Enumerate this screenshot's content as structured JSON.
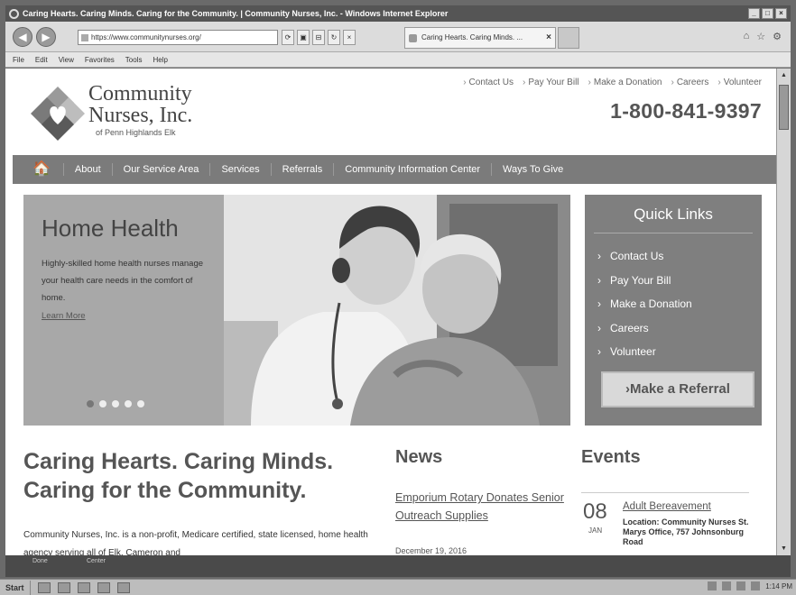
{
  "window": {
    "title": "Caring Hearts. Caring Minds. Caring for the Community. | Community Nurses, Inc. - Windows Internet Explorer",
    "controls": [
      "_",
      "□",
      "×"
    ]
  },
  "browser": {
    "url": "https://www.communitynurses.org/",
    "tab_title": "Caring Hearts. Caring Minds. ...",
    "tab_close": "×",
    "back": "◀",
    "forward": "▶",
    "address_buttons": [
      "⟳",
      "▣",
      "⊟",
      "↻",
      "×"
    ],
    "right_icons": [
      "⌂",
      "☆",
      "⚙"
    ],
    "menu": [
      "File",
      "Edit",
      "View",
      "Favorites",
      "Tools",
      "Help"
    ]
  },
  "site": {
    "brand_line1": "Community",
    "brand_line2": "Nurses, Inc.",
    "brand_line3": "of Penn Highlands Elk",
    "utility_links": [
      "Contact Us",
      "Pay Your Bill",
      "Make a Donation",
      "Careers",
      "Volunteer"
    ],
    "phone": "1-800-841-9397",
    "nav": {
      "home": "🏠",
      "items": [
        "About",
        "Our Service Area",
        "Services",
        "Referrals",
        "Community Information Center",
        "Ways To Give"
      ]
    },
    "hero": {
      "title": "Home Health",
      "description": "Highly-skilled home health nurses manage your health care needs in the comfort of home.",
      "link": "Learn More"
    },
    "quick_links": {
      "title": "Quick Links",
      "items": [
        "Contact Us",
        "Pay Your Bill",
        "Make a Donation",
        "Careers",
        "Volunteer"
      ],
      "referral": "Make a Referral"
    },
    "tagline": "Caring Hearts. Caring Minds. Caring for the Community.",
    "intro": "Community Nurses, Inc. is a non-profit, Medicare certified, state licensed, home health agency serving all of Elk, Cameron and",
    "news": {
      "heading": "News",
      "link": "Emporium Rotary Donates Senior Outreach Supplies",
      "date": "December 19, 2016"
    },
    "events": {
      "heading": "Events",
      "day": "08",
      "month": "JAN",
      "title": "Adult Bereavement",
      "detail": "Location: Community Nurses St. Marys Office, 757 Johnsonburg Road"
    }
  },
  "status": {
    "left": "Done",
    "zoom": "Center"
  },
  "taskbar": {
    "start": "Start",
    "clock": "1:14 PM"
  },
  "colors": {
    "nav": "#7b7b7b",
    "hero_panel": "#a8a8a8",
    "quick_links": "#7f7f7f"
  }
}
